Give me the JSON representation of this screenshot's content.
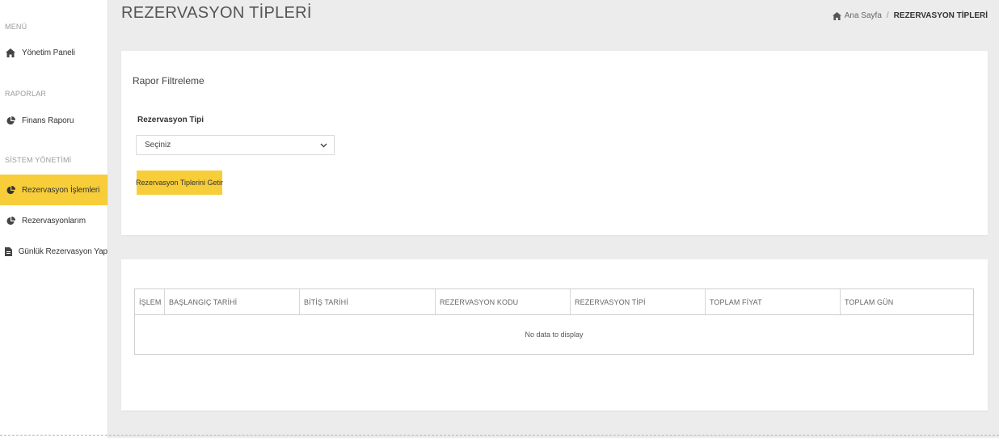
{
  "sidebar": {
    "sections": [
      {
        "header": "MENÜ"
      },
      {
        "header": "RAPORLAR"
      },
      {
        "header": "SİSTEM YÖNETİMİ"
      }
    ],
    "items": [
      {
        "label": "Yönetim Paneli",
        "icon": "home-icon"
      },
      {
        "label": "Finans Raporu",
        "icon": "pie-chart-icon"
      },
      {
        "label": "Rezervasyon İşlemleri",
        "icon": "pie-chart-icon",
        "active": true
      },
      {
        "label": "Rezervasyonlarım",
        "icon": "pie-chart-icon"
      },
      {
        "label": "Günlük Rezervasyon Yap",
        "icon": "document-icon"
      }
    ]
  },
  "header": {
    "title": "REZERVASYON TİPLERİ",
    "breadcrumb": {
      "home": "Ana Sayfa",
      "separator": "/",
      "current": "REZERVASYON TİPLERİ"
    }
  },
  "filter": {
    "title": "Rapor Filtreleme",
    "field_label": "Rezervasyon Tipi",
    "select_value": "Seçiniz",
    "button_label": "Rezervasyon Tiplerini Getir"
  },
  "table": {
    "columns": [
      "İŞLEM",
      "BAŞLANGIÇ TARİHİ",
      "BİTİŞ TARİHİ",
      "REZERVASYON KODU",
      "REZERVASYON TİPİ",
      "TOPLAM FİYAT",
      "TOPLAM GÜN"
    ],
    "empty_text": "No data to display"
  },
  "colors": {
    "accent": "#f7cd3a",
    "background": "#ececec"
  }
}
